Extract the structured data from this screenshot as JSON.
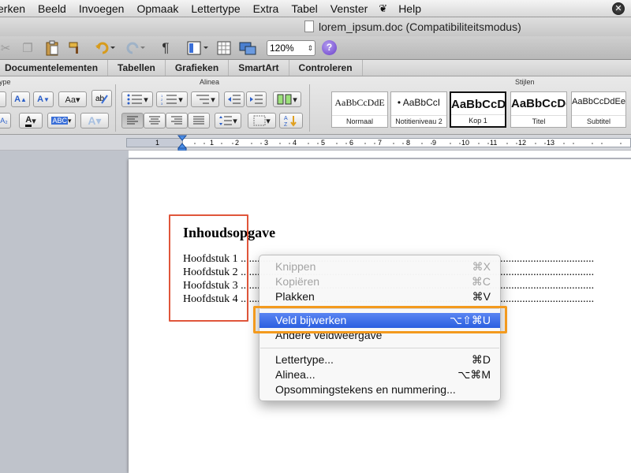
{
  "menubar": {
    "items": [
      "erken",
      "Beeld",
      "Invoegen",
      "Opmaak",
      "Lettertype",
      "Extra",
      "Tabel",
      "Venster",
      "Help"
    ],
    "script_icon": "script-icon",
    "close_icon": "close-circle-icon"
  },
  "window": {
    "title": "lorem_ipsum.doc (Compatibiliteitsmodus)"
  },
  "toolbar": {
    "zoom": "120%",
    "help_label": "?"
  },
  "ribbon_tabs": [
    "Documentelementen",
    "Tabellen",
    "Grafieken",
    "SmartArt",
    "Controleren"
  ],
  "ribbon": {
    "group_font_label": "ype",
    "group_paragraph_label": "Alinea",
    "group_styles_label": "Stijlen",
    "styles": [
      {
        "sample": "AaBbCcDdE",
        "name": "Normaal"
      },
      {
        "sample": "• AaBbCcI",
        "name": "Notitieniveau 2"
      },
      {
        "sample": "AaBbCcD",
        "name": "Kop 1"
      },
      {
        "sample": "AaBbCcDd",
        "name": "Titel"
      },
      {
        "sample": "AaBbCcDdEe",
        "name": "Subtitel"
      }
    ]
  },
  "ruler": {
    "numbers": [
      "1",
      "1",
      "1",
      "2",
      "3",
      "4",
      "5",
      "6",
      "7",
      "8",
      "9",
      "10",
      "11",
      "12",
      "13"
    ]
  },
  "document": {
    "heading": "Inhoudsopgave",
    "toc": [
      {
        "label": "Hoofdstuk 1",
        "dots": " ................................................................................................................................"
      },
      {
        "label": "Hoofdstuk 2",
        "dots": " ................................................................................................................................"
      },
      {
        "label": "Hoofdstuk 3",
        "dots": " ................................................................................................................................"
      },
      {
        "label": "Hoofdstuk 4",
        "dots": " ................................................................................................................................"
      }
    ]
  },
  "context_menu": {
    "items": [
      {
        "label": "Knippen",
        "shortcut": "⌘X",
        "disabled": true
      },
      {
        "label": "Kopiëren",
        "shortcut": "⌘C",
        "disabled": true
      },
      {
        "label": "Plakken",
        "shortcut": "⌘V",
        "disabled": false
      },
      {
        "label": "Veld bijwerken",
        "shortcut": "⌥⇧⌘U",
        "disabled": false,
        "highlighted": true
      },
      {
        "label": "Andere veldweergave",
        "shortcut": "",
        "disabled": false
      },
      {
        "label": "Lettertype...",
        "shortcut": "⌘D",
        "disabled": false
      },
      {
        "label": "Alinea...",
        "shortcut": "⌥⌘M",
        "disabled": false
      },
      {
        "label": "Opsommingstekens en nummering...",
        "shortcut": "",
        "disabled": false
      }
    ]
  },
  "colors": {
    "highlight": "#2b5fe0",
    "annotation_red": "#e0563b",
    "annotation_orange": "#f39a1e"
  }
}
